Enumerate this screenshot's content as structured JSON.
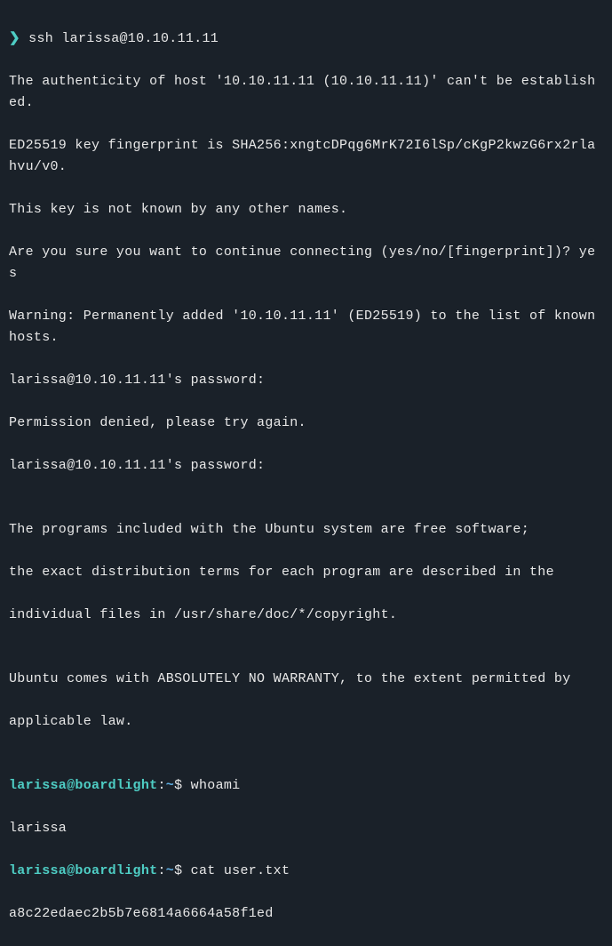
{
  "terminal": {
    "line1_prompt": "❯",
    "line1_cmd": " ssh larissa@10.10.11.11",
    "line2": "The authenticity of host '10.10.11.11 (10.10.11.11)' can't be established.",
    "line3": "ED25519 key fingerprint is SHA256:xngtcDPqg6MrK72I6lSp/cKgP2kwzG6rx2rlahvu/v0.",
    "line4": "This key is not known by any other names.",
    "line5": "Are you sure you want to continue connecting (yes/no/[fingerprint])? yes",
    "line6": "Warning: Permanently added '10.10.11.11' (ED25519) to the list of known hosts.",
    "line7": "larissa@10.10.11.11's password:",
    "line8": "Permission denied, please try again.",
    "line9": "larissa@10.10.11.11's password:",
    "line10": "The programs included with the Ubuntu system are free software;",
    "line11": "the exact distribution terms for each program are described in the",
    "line12": "individual files in /usr/share/doc/*/copyright.",
    "line13": "Ubuntu comes with ABSOLUTELY NO WARRANTY, to the extent permitted by",
    "line14": "applicable law.",
    "prompt1_userhost": "larissa@boardlight",
    "prompt1_colon": ":",
    "prompt1_path": "~",
    "prompt1_dollar": "$ ",
    "prompt1_cmd": "whoami",
    "whoami_out": "larissa",
    "prompt2_userhost": "larissa@boardlight",
    "prompt2_colon": ":",
    "prompt2_path": "~",
    "prompt2_dollar": "$ ",
    "prompt2_cmd": "cat user.txt",
    "flag_out": "a8c22edaec2b5b7e6814a6664a58f1ed"
  }
}
